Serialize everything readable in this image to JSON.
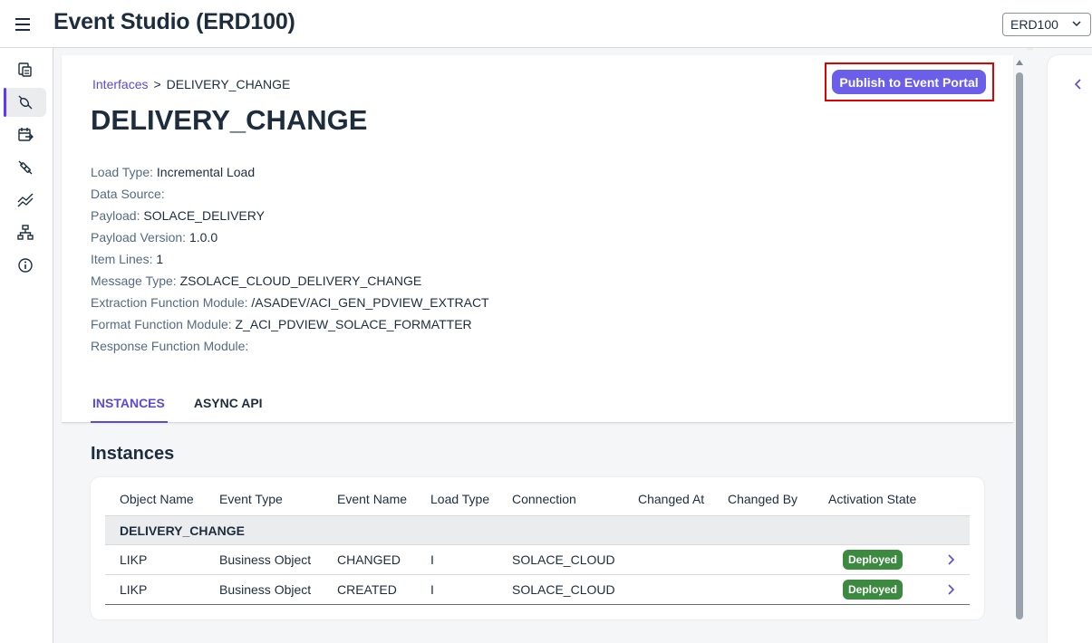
{
  "header": {
    "title": "Event Studio (ERD100)",
    "system_select": "ERD100"
  },
  "nav": {
    "items": [
      {
        "icon": "documents-icon"
      },
      {
        "icon": "connector-icon",
        "active": true
      },
      {
        "icon": "event-calendar-icon"
      },
      {
        "icon": "disconnected-icon"
      },
      {
        "icon": "trend-icon"
      },
      {
        "icon": "hierarchy-icon"
      },
      {
        "icon": "information-icon"
      }
    ]
  },
  "breadcrumb": {
    "parent": "Interfaces",
    "separator": ">",
    "current": "DELIVERY_CHANGE"
  },
  "actions": {
    "publish": "Publish to Event Portal"
  },
  "page": {
    "title": "DELIVERY_CHANGE"
  },
  "properties": [
    {
      "label": "Load Type:",
      "value": "Incremental Load"
    },
    {
      "label": "Data Source:",
      "value": ""
    },
    {
      "label": "Payload:",
      "value": "SOLACE_DELIVERY"
    },
    {
      "label": "Payload Version:",
      "value": "1.0.0"
    },
    {
      "label": "Item Lines:",
      "value": "1"
    },
    {
      "label": "Message Type:",
      "value": "ZSOLACE_CLOUD_DELIVERY_CHANGE"
    },
    {
      "label": "Extraction Function Module:",
      "value": "/ASADEV/ACI_GEN_PDVIEW_EXTRACT"
    },
    {
      "label": "Format Function Module:",
      "value": "Z_ACI_PDVIEW_SOLACE_FORMATTER"
    },
    {
      "label": "Response Function Module:",
      "value": ""
    }
  ],
  "tabs": [
    {
      "label": "INSTANCES",
      "active": true
    },
    {
      "label": "ASYNC API",
      "active": false
    }
  ],
  "instances": {
    "title": "Instances",
    "columns": [
      "Object Name",
      "Event Type",
      "Event Name",
      "Load Type",
      "Connection",
      "Changed At",
      "Changed By",
      "Activation State"
    ],
    "group": "DELIVERY_CHANGE",
    "rows": [
      {
        "object_name": "LIKP",
        "event_type": "Business Object",
        "event_name": "CHANGED",
        "load_type": "I",
        "connection": "SOLACE_CLOUD",
        "changed_at": "",
        "changed_by": "",
        "state": "Deployed"
      },
      {
        "object_name": "LIKP",
        "event_type": "Business Object",
        "event_name": "CREATED",
        "load_type": "I",
        "connection": "SOLACE_CLOUD",
        "changed_at": "",
        "changed_by": "",
        "state": "Deployed"
      }
    ]
  },
  "colors": {
    "accent": "#5b4ad6",
    "publish_button": "#6b5ee8",
    "highlight_border": "#e00000",
    "deployed_badge": "#3c8a3f"
  }
}
